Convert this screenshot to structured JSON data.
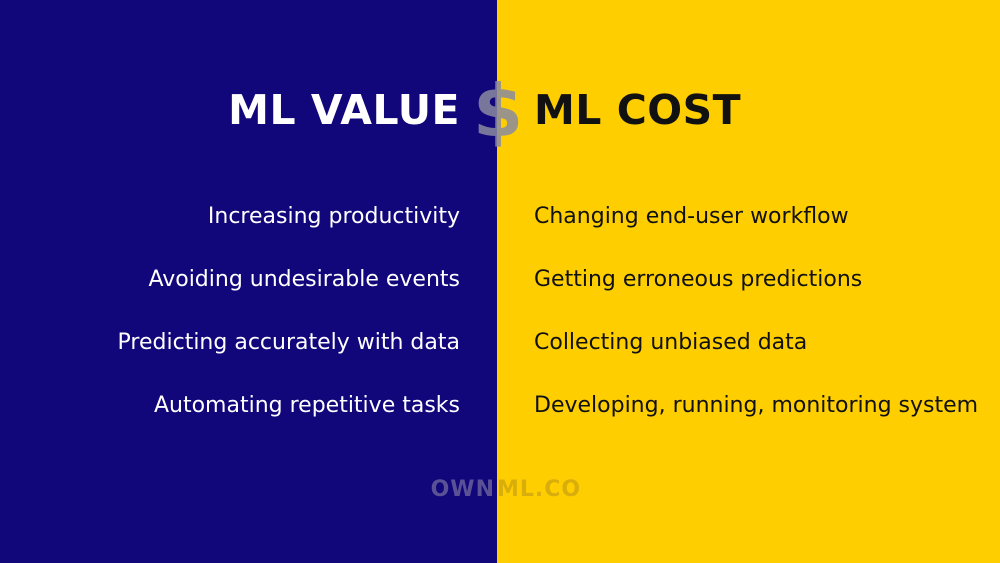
{
  "slide": {
    "colors": {
      "left_bg": "#11067a",
      "right_bg": "#fece00",
      "left_text": "#ffffff",
      "right_text": "#111111"
    },
    "left": {
      "title": "ML VALUE",
      "items": [
        "Increasing productivity",
        "Avoiding undesirable events",
        "Predicting accurately with data",
        "Automating repetitive tasks"
      ]
    },
    "divider_symbol": "$",
    "right": {
      "title": "ML COST",
      "items": [
        "Changing end-user workflow",
        "Getting erroneous predictions",
        "Collecting unbiased data",
        "Developing, running, monitoring system"
      ]
    },
    "brand": {
      "left_part": "OWN",
      "right_part": "ML.CO"
    }
  }
}
